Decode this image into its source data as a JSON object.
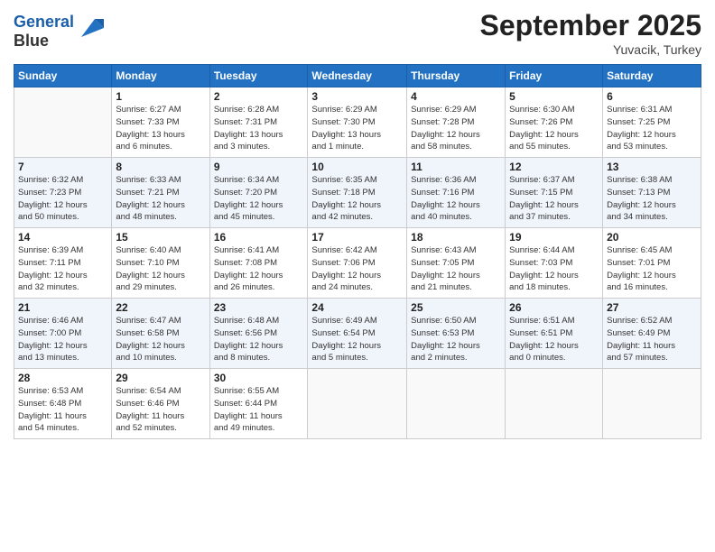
{
  "header": {
    "logo_line1": "General",
    "logo_line2": "Blue",
    "month_title": "September 2025",
    "location": "Yuvacik, Turkey"
  },
  "columns": [
    "Sunday",
    "Monday",
    "Tuesday",
    "Wednesday",
    "Thursday",
    "Friday",
    "Saturday"
  ],
  "weeks": [
    [
      {
        "day": "",
        "info": ""
      },
      {
        "day": "1",
        "info": "Sunrise: 6:27 AM\nSunset: 7:33 PM\nDaylight: 13 hours\nand 6 minutes."
      },
      {
        "day": "2",
        "info": "Sunrise: 6:28 AM\nSunset: 7:31 PM\nDaylight: 13 hours\nand 3 minutes."
      },
      {
        "day": "3",
        "info": "Sunrise: 6:29 AM\nSunset: 7:30 PM\nDaylight: 13 hours\nand 1 minute."
      },
      {
        "day": "4",
        "info": "Sunrise: 6:29 AM\nSunset: 7:28 PM\nDaylight: 12 hours\nand 58 minutes."
      },
      {
        "day": "5",
        "info": "Sunrise: 6:30 AM\nSunset: 7:26 PM\nDaylight: 12 hours\nand 55 minutes."
      },
      {
        "day": "6",
        "info": "Sunrise: 6:31 AM\nSunset: 7:25 PM\nDaylight: 12 hours\nand 53 minutes."
      }
    ],
    [
      {
        "day": "7",
        "info": "Sunrise: 6:32 AM\nSunset: 7:23 PM\nDaylight: 12 hours\nand 50 minutes."
      },
      {
        "day": "8",
        "info": "Sunrise: 6:33 AM\nSunset: 7:21 PM\nDaylight: 12 hours\nand 48 minutes."
      },
      {
        "day": "9",
        "info": "Sunrise: 6:34 AM\nSunset: 7:20 PM\nDaylight: 12 hours\nand 45 minutes."
      },
      {
        "day": "10",
        "info": "Sunrise: 6:35 AM\nSunset: 7:18 PM\nDaylight: 12 hours\nand 42 minutes."
      },
      {
        "day": "11",
        "info": "Sunrise: 6:36 AM\nSunset: 7:16 PM\nDaylight: 12 hours\nand 40 minutes."
      },
      {
        "day": "12",
        "info": "Sunrise: 6:37 AM\nSunset: 7:15 PM\nDaylight: 12 hours\nand 37 minutes."
      },
      {
        "day": "13",
        "info": "Sunrise: 6:38 AM\nSunset: 7:13 PM\nDaylight: 12 hours\nand 34 minutes."
      }
    ],
    [
      {
        "day": "14",
        "info": "Sunrise: 6:39 AM\nSunset: 7:11 PM\nDaylight: 12 hours\nand 32 minutes."
      },
      {
        "day": "15",
        "info": "Sunrise: 6:40 AM\nSunset: 7:10 PM\nDaylight: 12 hours\nand 29 minutes."
      },
      {
        "day": "16",
        "info": "Sunrise: 6:41 AM\nSunset: 7:08 PM\nDaylight: 12 hours\nand 26 minutes."
      },
      {
        "day": "17",
        "info": "Sunrise: 6:42 AM\nSunset: 7:06 PM\nDaylight: 12 hours\nand 24 minutes."
      },
      {
        "day": "18",
        "info": "Sunrise: 6:43 AM\nSunset: 7:05 PM\nDaylight: 12 hours\nand 21 minutes."
      },
      {
        "day": "19",
        "info": "Sunrise: 6:44 AM\nSunset: 7:03 PM\nDaylight: 12 hours\nand 18 minutes."
      },
      {
        "day": "20",
        "info": "Sunrise: 6:45 AM\nSunset: 7:01 PM\nDaylight: 12 hours\nand 16 minutes."
      }
    ],
    [
      {
        "day": "21",
        "info": "Sunrise: 6:46 AM\nSunset: 7:00 PM\nDaylight: 12 hours\nand 13 minutes."
      },
      {
        "day": "22",
        "info": "Sunrise: 6:47 AM\nSunset: 6:58 PM\nDaylight: 12 hours\nand 10 minutes."
      },
      {
        "day": "23",
        "info": "Sunrise: 6:48 AM\nSunset: 6:56 PM\nDaylight: 12 hours\nand 8 minutes."
      },
      {
        "day": "24",
        "info": "Sunrise: 6:49 AM\nSunset: 6:54 PM\nDaylight: 12 hours\nand 5 minutes."
      },
      {
        "day": "25",
        "info": "Sunrise: 6:50 AM\nSunset: 6:53 PM\nDaylight: 12 hours\nand 2 minutes."
      },
      {
        "day": "26",
        "info": "Sunrise: 6:51 AM\nSunset: 6:51 PM\nDaylight: 12 hours\nand 0 minutes."
      },
      {
        "day": "27",
        "info": "Sunrise: 6:52 AM\nSunset: 6:49 PM\nDaylight: 11 hours\nand 57 minutes."
      }
    ],
    [
      {
        "day": "28",
        "info": "Sunrise: 6:53 AM\nSunset: 6:48 PM\nDaylight: 11 hours\nand 54 minutes."
      },
      {
        "day": "29",
        "info": "Sunrise: 6:54 AM\nSunset: 6:46 PM\nDaylight: 11 hours\nand 52 minutes."
      },
      {
        "day": "30",
        "info": "Sunrise: 6:55 AM\nSunset: 6:44 PM\nDaylight: 11 hours\nand 49 minutes."
      },
      {
        "day": "",
        "info": ""
      },
      {
        "day": "",
        "info": ""
      },
      {
        "day": "",
        "info": ""
      },
      {
        "day": "",
        "info": ""
      }
    ]
  ]
}
